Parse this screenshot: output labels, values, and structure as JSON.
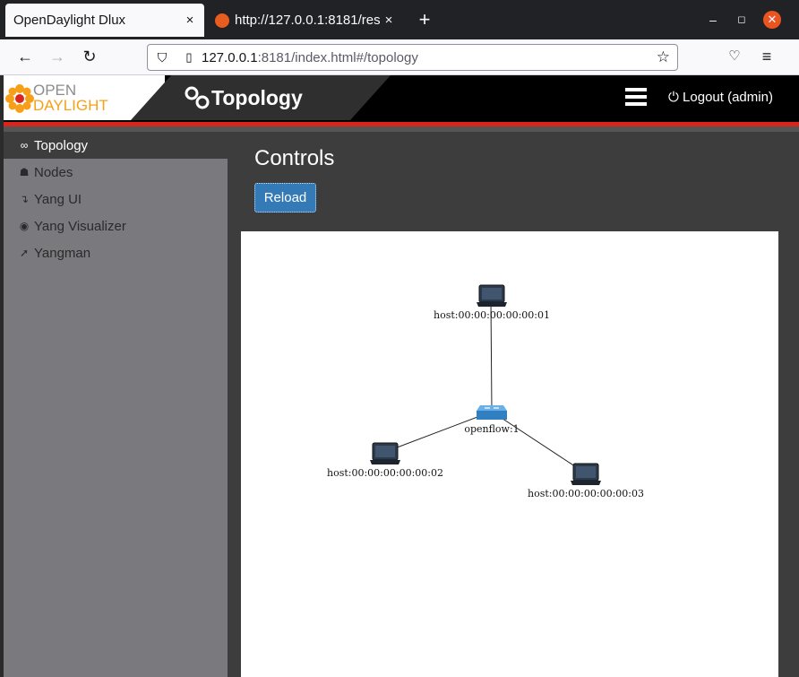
{
  "browser": {
    "tabs": [
      {
        "title": "OpenDaylight Dlux",
        "active": true
      },
      {
        "title": "http://127.0.0.1:8181/res",
        "active": false
      }
    ],
    "url_host": "127.0.0.1",
    "url_rest": ":8181/index.html#/topology",
    "new_tab": "+",
    "close_glyph": "×"
  },
  "header": {
    "logo_line1": "OPEN",
    "logo_line2": "DAYLIGHT",
    "title": "Topology",
    "logout": "Logout (admin)"
  },
  "sidebar": {
    "items": [
      {
        "label": "Topology",
        "icon": "link-icon",
        "active": true
      },
      {
        "label": "Nodes",
        "icon": "sitemap-icon",
        "active": false
      },
      {
        "label": "Yang UI",
        "icon": "level-down-icon",
        "active": false
      },
      {
        "label": "Yang Visualizer",
        "icon": "eye-icon",
        "active": false
      },
      {
        "label": "Yangman",
        "icon": "rocket-icon",
        "active": false
      }
    ]
  },
  "main": {
    "heading": "Controls",
    "reload_label": "Reload"
  },
  "topology": {
    "nodes": [
      {
        "id": "host:00:00:00:00:00:01",
        "type": "host"
      },
      {
        "id": "openflow:1",
        "type": "switch"
      },
      {
        "id": "host:00:00:00:00:00:02",
        "type": "host"
      },
      {
        "id": "host:00:00:00:00:00:03",
        "type": "host"
      }
    ],
    "links": [
      [
        "openflow:1",
        "host:00:00:00:00:00:01"
      ],
      [
        "openflow:1",
        "host:00:00:00:00:00:02"
      ],
      [
        "openflow:1",
        "host:00:00:00:00:00:03"
      ]
    ]
  },
  "colors": {
    "accent_red": "#d9251c",
    "button_blue": "#337ab7",
    "logo_orange": "#f6a01a"
  }
}
